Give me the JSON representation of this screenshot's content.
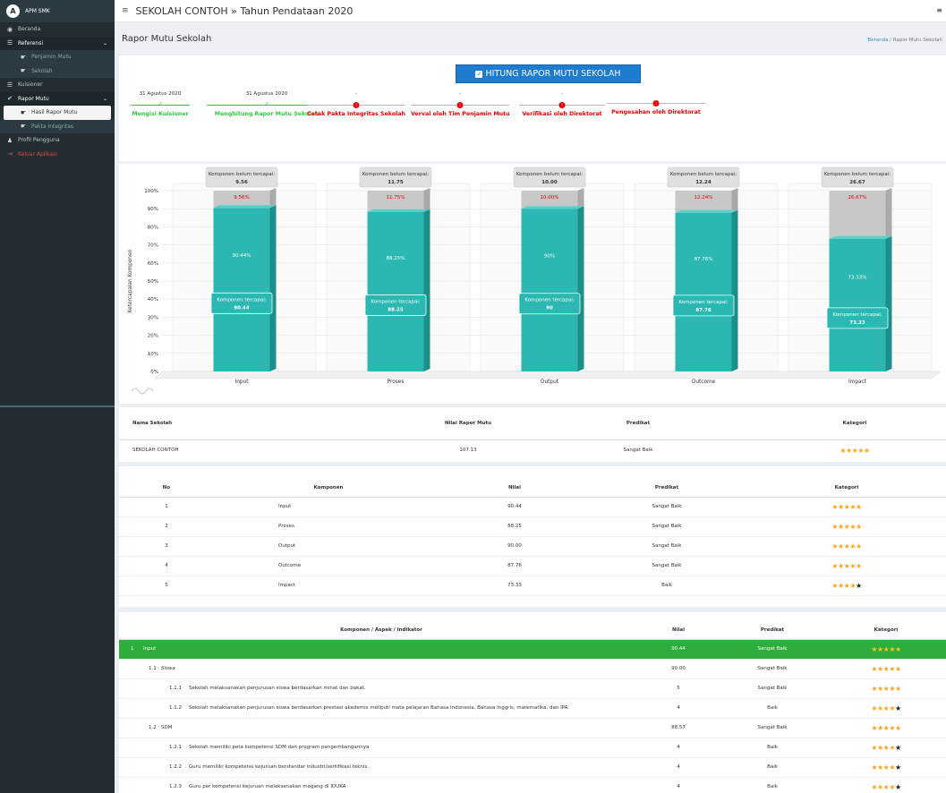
{
  "app": {
    "brand": "APM SMK",
    "logo_letter": "A"
  },
  "header": {
    "title": "SEKOLAH CONTOH » Tahun Pendataan 2020"
  },
  "sidebar": {
    "items": [
      {
        "label": "Beranda",
        "icon": "dashboard-icon"
      },
      {
        "label": "Referensi",
        "icon": "list-icon"
      },
      {
        "label": "Penjamin Mutu",
        "icon": "hand-point-icon"
      },
      {
        "label": "Sekolah",
        "icon": "hand-point-icon"
      },
      {
        "label": "Kuisioner",
        "icon": "list-icon"
      },
      {
        "label": "Rapor Mutu",
        "icon": "check-icon"
      },
      {
        "label": "Hasil Rapor Mutu",
        "icon": "hand-point-icon"
      },
      {
        "label": "Pakta Integritas",
        "icon": "hand-point-icon"
      },
      {
        "label": "Profil Pengguna",
        "icon": "user-icon"
      },
      {
        "label": "Keluar Aplikasi",
        "icon": "sign-out-icon"
      }
    ]
  },
  "page": {
    "title": "Rapor Mutu Sekolah",
    "breadcrumb_home": "Beranda",
    "breadcrumb_sep": "/",
    "breadcrumb_current": "Rapor Mutu Sekolah"
  },
  "action": {
    "calc_label": "HITUNG RAPOR MUTU SEKOLAH"
  },
  "steps": [
    {
      "date": "31 Agustus 2020",
      "label": "Mengisi Kuisioner",
      "status": "done"
    },
    {
      "date": "31 Agustus 2020",
      "label": "Menghitung Rapor Mutu Sekolah",
      "status": "done"
    },
    {
      "date": "-",
      "label": "Cetak Pakta Integritas Sekolah",
      "status": "pending"
    },
    {
      "date": "-",
      "label": "Verval oleh Tim Penjamin Mutu",
      "status": "pending"
    },
    {
      "date": "-",
      "label": "Verifikasi oleh Direktorat",
      "status": "pending"
    },
    {
      "date": "",
      "label": "Pengesahan oleh Direktorat",
      "status": "pending"
    }
  ],
  "colors": {
    "bar": "#2bb7b2",
    "bar_dark": "#1e8e89",
    "remaining": "#c8c8c8",
    "green": "#2eac3c",
    "red": "#e00000",
    "star": "#f5a623",
    "primary": "#1e7cd0"
  },
  "chart_data": {
    "type": "bar",
    "ylabel": "Ketercapaian Komponen",
    "ylim": [
      0,
      100
    ],
    "yticks": [
      "0%",
      "10%",
      "20%",
      "30%",
      "40%",
      "50%",
      "60%",
      "70%",
      "80%",
      "90%",
      "100%"
    ],
    "categories": [
      "Input",
      "Proses",
      "Output",
      "Outcome",
      "Impact"
    ],
    "series": [
      {
        "name": "Komponen tercapai",
        "values": [
          90.44,
          88.25,
          90,
          87.76,
          73.33
        ],
        "labels": [
          "90.44%",
          "88.25%",
          "90%",
          "87.76%",
          "73.33%"
        ],
        "tooltip_values": [
          "90.44",
          "88.25",
          "90",
          "87.76",
          "73.33"
        ]
      },
      {
        "name": "Komponen belum tercapai",
        "values": [
          9.56,
          11.75,
          10,
          12.24,
          26.67
        ],
        "labels": [
          "9.56%",
          "11.75%",
          "10.00%",
          "12.24%",
          "26.67%"
        ],
        "tooltip_values": [
          "9.56",
          "11.75",
          "10.00",
          "12.24",
          "26.67"
        ]
      }
    ],
    "tooltip_achieved_title": "Komponen tercapai:",
    "tooltip_unmet_title": "Komponen belum tercapai:"
  },
  "summary": {
    "headers": {
      "school": "Nama Sekolah",
      "score": "Nilai Rapor Mutu",
      "predikat": "Predikat",
      "kategori": "Kategori"
    },
    "row": {
      "school": "SEKOLAH CONTOH",
      "score": "107.13",
      "predikat": "Sangat Baik",
      "stars": 5
    }
  },
  "komponen": {
    "headers": {
      "no": "No",
      "komponen": "Komponen",
      "nilai": "Nilai",
      "predikat": "Predikat",
      "kategori": "Kategori"
    },
    "rows": [
      {
        "no": "1",
        "komponen": "Input",
        "nilai": "90.44",
        "predikat": "Sangat Baik",
        "stars": 5
      },
      {
        "no": "2",
        "komponen": "Proses",
        "nilai": "88.25",
        "predikat": "Sangat Baik",
        "stars": 5
      },
      {
        "no": "3",
        "komponen": "Output",
        "nilai": "90.00",
        "predikat": "Sangat Baik",
        "stars": 5
      },
      {
        "no": "4",
        "komponen": "Outcome",
        "nilai": "87.76",
        "predikat": "Sangat Baik",
        "stars": 5
      },
      {
        "no": "5",
        "komponen": "Impact",
        "nilai": "73.33",
        "predikat": "Baik",
        "stars": 4
      }
    ]
  },
  "detail": {
    "headers": {
      "komponen": "Komponen / Aspek / Indikator",
      "nilai": "Nilai",
      "predikat": "Predikat",
      "kategori": "Kategori"
    },
    "rows": [
      {
        "level": 0,
        "code": "1",
        "text": "Input",
        "nilai": "90.44",
        "predikat": "Sangat Baik",
        "stars": 5
      },
      {
        "level": 1,
        "code": "1.1",
        "text": "Siswa",
        "nilai": "90.00",
        "predikat": "Sangat Baik",
        "stars": 5
      },
      {
        "level": 2,
        "code": "1.1.1",
        "text": "Sekolah melaksanakan penjurusan siswa berdasarkan minat dan bakat.",
        "nilai": "5",
        "predikat": "Sangat Baik",
        "stars": 5
      },
      {
        "level": 2,
        "code": "1.1.2",
        "text": "Sekolah melaksanakan penjurusan siswa berdasarkan prestasi akademis meliputi mata pelajaran Bahasa Indonesia, Bahasa Inggris, matematika, dan IPA.",
        "nilai": "4",
        "predikat": "Baik",
        "stars": 4
      },
      {
        "level": 1,
        "code": "1.2",
        "text": "SDM",
        "nilai": "88.57",
        "predikat": "Sangat Baik",
        "stars": 5
      },
      {
        "level": 2,
        "code": "1.2.1",
        "text": "Sekolah memiliki peta kompetensi SDM dan program pengembangannya",
        "nilai": "4",
        "predikat": "Baik",
        "stars": 4
      },
      {
        "level": 2,
        "code": "1.2.2",
        "text": "Guru memiliki kompetensi kejuruan berstandar industri/sertifikasi teknis.",
        "nilai": "4",
        "predikat": "Baik",
        "stars": 4
      },
      {
        "level": 2,
        "code": "1.2.3",
        "text": "Guru per kompetensi kejuruan melaksanakan magang di IDUKA",
        "nilai": "4",
        "predikat": "Baik",
        "stars": 4
      }
    ]
  }
}
